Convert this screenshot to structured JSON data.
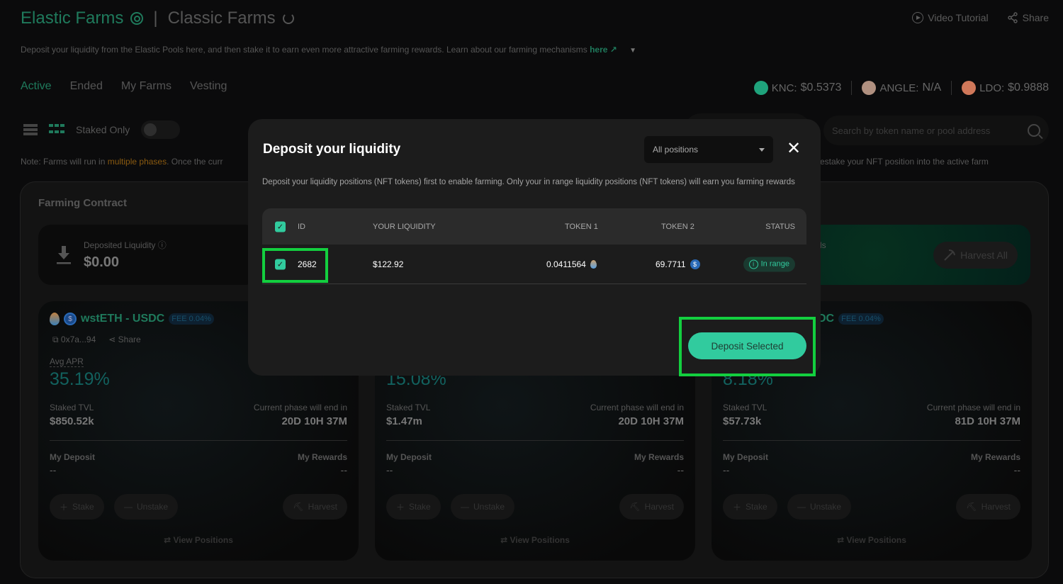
{
  "header": {
    "elastic_title": "Elastic Farms",
    "separator": "|",
    "classic_title": "Classic Farms",
    "video_tutorial": "Video Tutorial",
    "share": "Share",
    "subtitle": "Deposit your liquidity from the Elastic Pools here, and then stake it to earn even more attractive farming rewards. Learn about our farming mechanisms",
    "subtitle_link": "here ↗"
  },
  "tabs": [
    "Active",
    "Ended",
    "My Farms",
    "Vesting"
  ],
  "prices": [
    {
      "symbol": "KNC:",
      "value": "$0.5373",
      "color": "#1fa37c"
    },
    {
      "symbol": "ANGLE:",
      "value": "N/A",
      "color": "#b09080"
    },
    {
      "symbol": "LDO:",
      "value": "$0.9888",
      "color": "#d0785a"
    }
  ],
  "toolbar": {
    "staked_only": "Staked Only",
    "staked_only_on": false
  },
  "search": {
    "placeholder": "Search by token name or pool address"
  },
  "note": {
    "prefix": "Note: Farms will run in",
    "link": "multiple phases",
    "suffix": ". Once the curr",
    "right": "estake your NFT position into the active farm"
  },
  "contract": {
    "title": "Farming Contract",
    "deposited_label": "Deposited Liquidity ⓘ",
    "deposited_value": "$0.00",
    "rewards_label": "rds",
    "harvest_all": "Harvest All"
  },
  "farms": [
    {
      "pair": "wstETH - USDC",
      "fee": "FEE 0.04%",
      "address": "0x7a...94",
      "share": "Share",
      "apr_label": "Avg APR",
      "apr": "35.19%",
      "tvl_label": "Staked TVL",
      "tvl": "$850.52k",
      "phase_label": "Current phase will end in",
      "phase": "20D 10H 37M",
      "deposit_label": "My Deposit",
      "deposit": "--",
      "rewards_label": "My Rewards",
      "rewards": "--",
      "stake": "Stake",
      "unstake": "Unstake",
      "harvest": "Harvest",
      "view_positions": "View Positions"
    },
    {
      "pair": "",
      "fee": "",
      "address": "",
      "share": "",
      "apr_label": "",
      "apr": "15.08%",
      "tvl_label": "Staked TVL",
      "tvl": "$1.47m",
      "phase_label": "Current phase will end in",
      "phase": "20D 10H 37M",
      "deposit_label": "My Deposit",
      "deposit": "--",
      "rewards_label": "My Rewards",
      "rewards": "--",
      "stake": "Stake",
      "unstake": "Unstake",
      "harvest": "Harvest",
      "view_positions": "View Positions"
    },
    {
      "pair": "DC",
      "fee": "FEE 0.04%",
      "address": "",
      "share": "",
      "apr_label": "",
      "apr": "8.18%",
      "tvl_label": "Staked TVL",
      "tvl": "$57.73k",
      "phase_label": "Current phase will end in",
      "phase": "81D 10H 37M",
      "deposit_label": "My Deposit",
      "deposit": "--",
      "rewards_label": "My Rewards",
      "rewards": "--",
      "stake": "Stake",
      "unstake": "Unstake",
      "harvest": "Harvest",
      "view_positions": "View Positions"
    }
  ],
  "modal": {
    "title": "Deposit your liquidity",
    "filter": "All positions",
    "close": "✕",
    "description": "Deposit your liquidity positions (NFT tokens) first to enable farming. Only your in range liquidity positions (NFT tokens) will earn you farming rewards",
    "columns": [
      "ID",
      "YOUR LIQUIDITY",
      "TOKEN 1",
      "TOKEN 2",
      "STATUS"
    ],
    "rows": [
      {
        "checked": true,
        "id": "2682",
        "liquidity": "$122.92",
        "token1": "0.0411564",
        "token2": "69.7711",
        "status": "In range"
      }
    ],
    "deposit_button": "Deposit Selected"
  },
  "colors": {
    "accent": "#31cb9e",
    "brand_green": "#1f7a5c",
    "highlight": "#13cf3f"
  }
}
